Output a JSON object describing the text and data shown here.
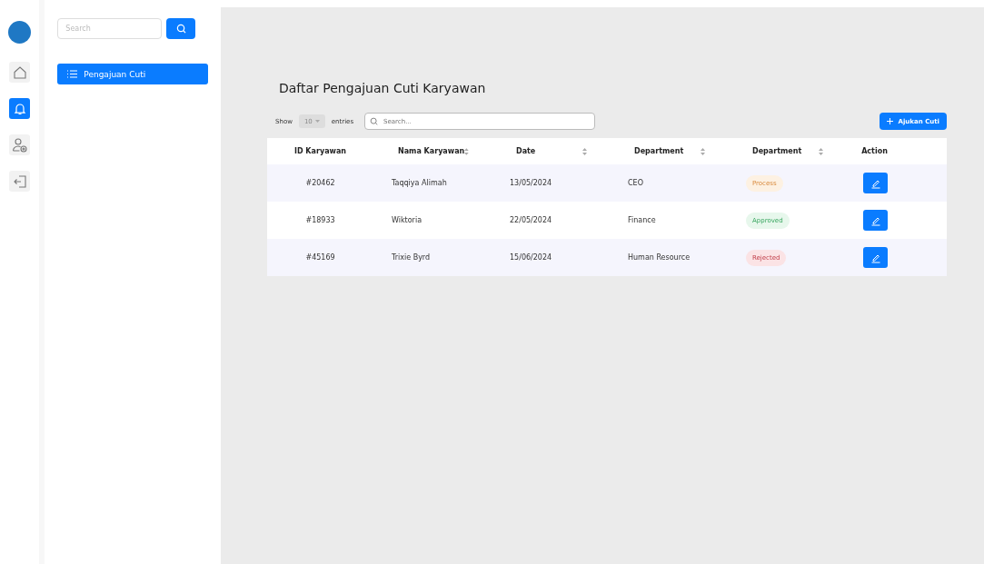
{
  "rail": [
    {
      "kind": "home",
      "selected": false
    },
    {
      "kind": "bell",
      "selected": true
    },
    {
      "kind": "user",
      "selected": false
    },
    {
      "kind": "logout",
      "selected": false
    }
  ],
  "sidebar": {
    "search": {
      "placeholder": "Search"
    },
    "items": [
      {
        "label": "Pengajuan Cuti",
        "selected": true
      }
    ]
  },
  "page_title": "Daftar Pengajuan Cuti Karyawan",
  "controls": {
    "show_label": "Show",
    "page_size": "10",
    "entries_label": "entries",
    "search": {
      "placeholder": "Search..."
    },
    "add_button": "Ajukan Cuti"
  },
  "table": {
    "columns": [
      {
        "label": "ID Karyawan",
        "sortable": false
      },
      {
        "label": "Nama Karyawan",
        "sortable": true
      },
      {
        "label": "Date",
        "sortable": true
      },
      {
        "label": "Department",
        "sortable": true
      },
      {
        "label": "Department",
        "sortable": true
      },
      {
        "label": "Action",
        "sortable": false
      }
    ],
    "rows": [
      {
        "id": "#20462",
        "name": "Taqqiya Alimah",
        "date": "13/05/2024",
        "department": "CEO",
        "status": "Process",
        "kind": "process"
      },
      {
        "id": "#18933",
        "name": "Wiktoria",
        "date": "22/05/2024",
        "department": "Finance",
        "status": "Approved",
        "kind": "approved"
      },
      {
        "id": "#45169",
        "name": "Trixie Byrd",
        "date": "15/06/2024",
        "department": "Human Resource",
        "status": "Rejected",
        "kind": "rejected"
      }
    ]
  }
}
